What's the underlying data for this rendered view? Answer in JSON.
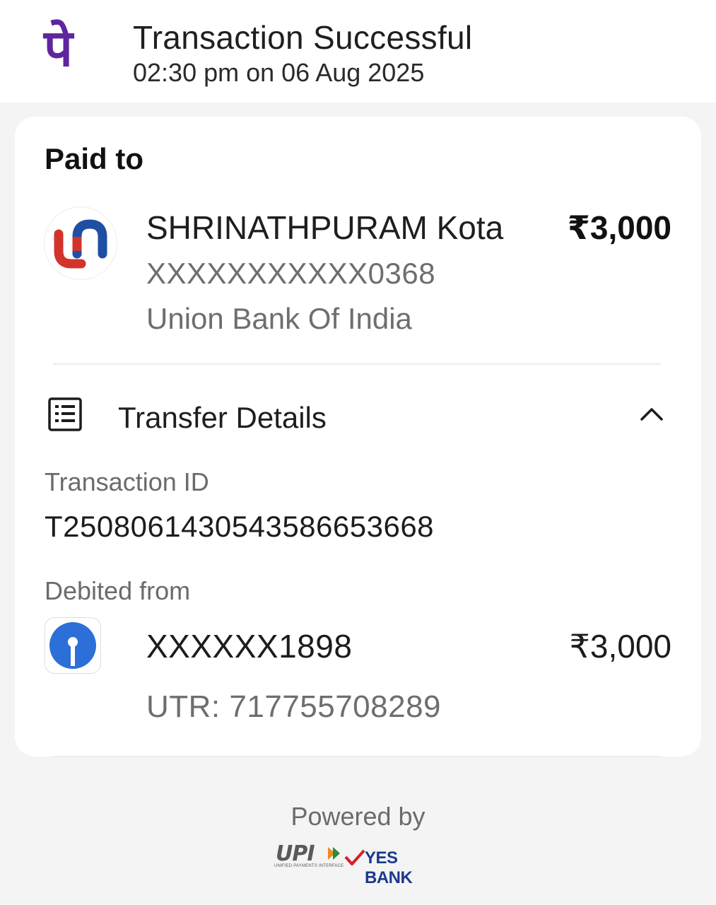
{
  "header": {
    "brand_glyph": "पे",
    "brand_color": "#5f259f",
    "status_title": "Transaction Successful",
    "status_time": "02:30 pm on 06 Aug 2025"
  },
  "paid_to": {
    "heading": "Paid to",
    "payee_name": "SHRINATHPURAM Kota",
    "amount": "₹3,000",
    "account": "XXXXXXXXXXX0368",
    "bank": "Union Bank Of India",
    "bank_logo_icon": "union-bank-logo"
  },
  "transfer_details": {
    "title": "Transfer Details",
    "icon": "receipt-list-icon",
    "expanded": true,
    "transaction_id_label": "Transaction ID",
    "transaction_id": "T2508061430543586653668",
    "debited_from_label": "Debited from",
    "debit_account": "XXXXXX1898",
    "debit_amount": "₹3,000",
    "utr": "UTR: 717755708289",
    "debit_bank_logo_icon": "sbi-logo"
  },
  "footer": {
    "powered_by": "Powered by",
    "upi_label": "UPI",
    "upi_subtitle": "UNIFIED PAYMENTS INTERFACE",
    "partner_bank": "YES BANK"
  }
}
